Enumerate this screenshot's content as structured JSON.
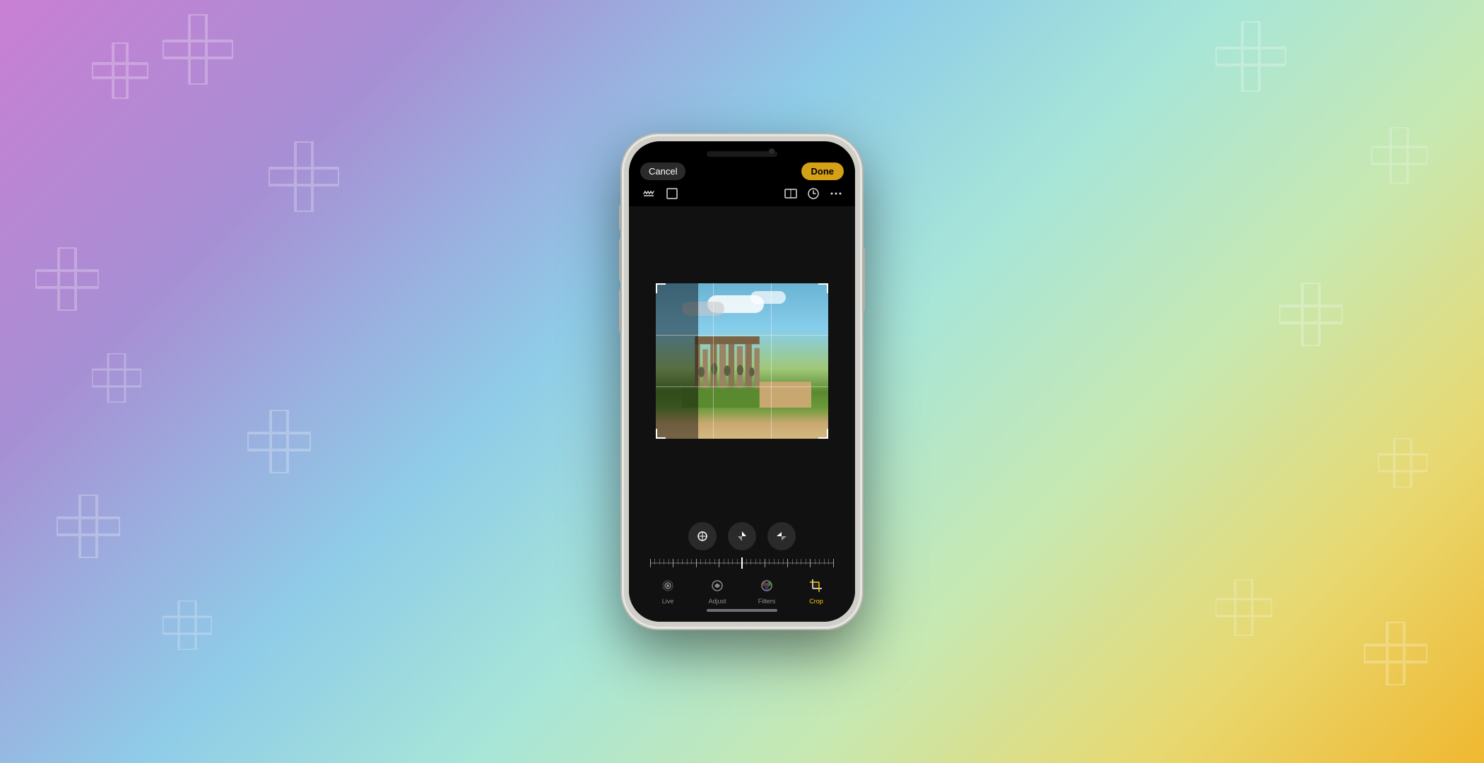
{
  "background": {
    "gradient": "purple to yellow"
  },
  "phone": {
    "topBar": {
      "cancelLabel": "Cancel",
      "doneLabel": "Done"
    },
    "toolbarIcons": {
      "leftIcons": [
        "straighten-icon",
        "crop-free-icon"
      ],
      "rightIcons": [
        "aspect-ratio-icon",
        "circle-arrow-icon",
        "more-icon"
      ]
    },
    "imageArea": {
      "description": "Photo of Roman aqueduct with crop overlay and grid lines"
    },
    "rotationControls": {
      "buttons": [
        "perspective-icon",
        "vertical-flip-icon",
        "horizontal-flip-icon"
      ]
    },
    "sliderValue": "0",
    "tabs": [
      {
        "id": "live",
        "label": "Live",
        "icon": "live-photo-icon",
        "active": false
      },
      {
        "id": "adjust",
        "label": "Adjust",
        "icon": "adjust-icon",
        "active": false
      },
      {
        "id": "filters",
        "label": "Filters",
        "icon": "filters-icon",
        "active": false
      },
      {
        "id": "crop",
        "label": "Crop",
        "icon": "crop-icon",
        "active": true
      }
    ],
    "homeIndicator": ""
  }
}
